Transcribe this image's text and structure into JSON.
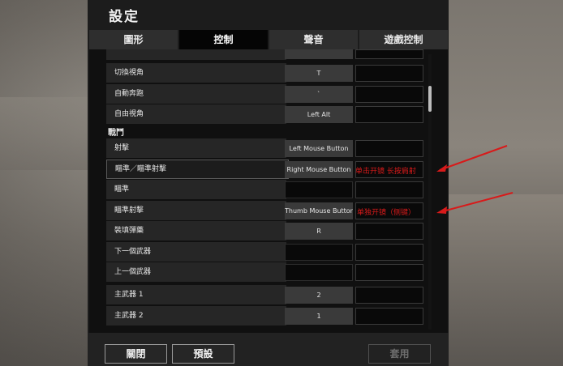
{
  "window": {
    "title": "設定"
  },
  "tabs": [
    {
      "label": "圖形",
      "active": false
    },
    {
      "label": "控制",
      "active": true
    },
    {
      "label": "聲音",
      "active": false
    },
    {
      "label": "遊戲控制",
      "active": false
    }
  ],
  "section": {
    "label": "戰鬥"
  },
  "rows_top": [
    {
      "label": "切換視角",
      "key1": "T",
      "key2": ""
    },
    {
      "label": "自動奔跑",
      "key1": "`",
      "key2": ""
    },
    {
      "label": "自由視角",
      "key1": "Left Alt",
      "key2": ""
    }
  ],
  "rows_combat": [
    {
      "label": "射擊",
      "key1": "Left Mouse Button",
      "key2": ""
    },
    {
      "label": "瞄準／瞄準射擊",
      "key1": "Right Mouse Button",
      "key2": ""
    },
    {
      "label": "瞄準",
      "key1": "",
      "key2": ""
    },
    {
      "label": "瞄準射擊",
      "key1": "Thumb Mouse Button 2",
      "key2": ""
    },
    {
      "label": "裝填彈藥",
      "key1": "R",
      "key2": ""
    },
    {
      "label": "下一個武器",
      "key1": "",
      "key2": ""
    },
    {
      "label": "上一個武器",
      "key1": "",
      "key2": ""
    },
    {
      "label": "主武器 1",
      "key1": "2",
      "key2": ""
    },
    {
      "label": "主武器 2",
      "key1": "1",
      "key2": ""
    }
  ],
  "footer": {
    "close": "關閉",
    "default": "預設",
    "apply": "套用"
  },
  "annotations": {
    "note1": "单击开镜  长按肩射",
    "note2": "单独开镜（侧键）",
    "color": "#d81a1a"
  }
}
